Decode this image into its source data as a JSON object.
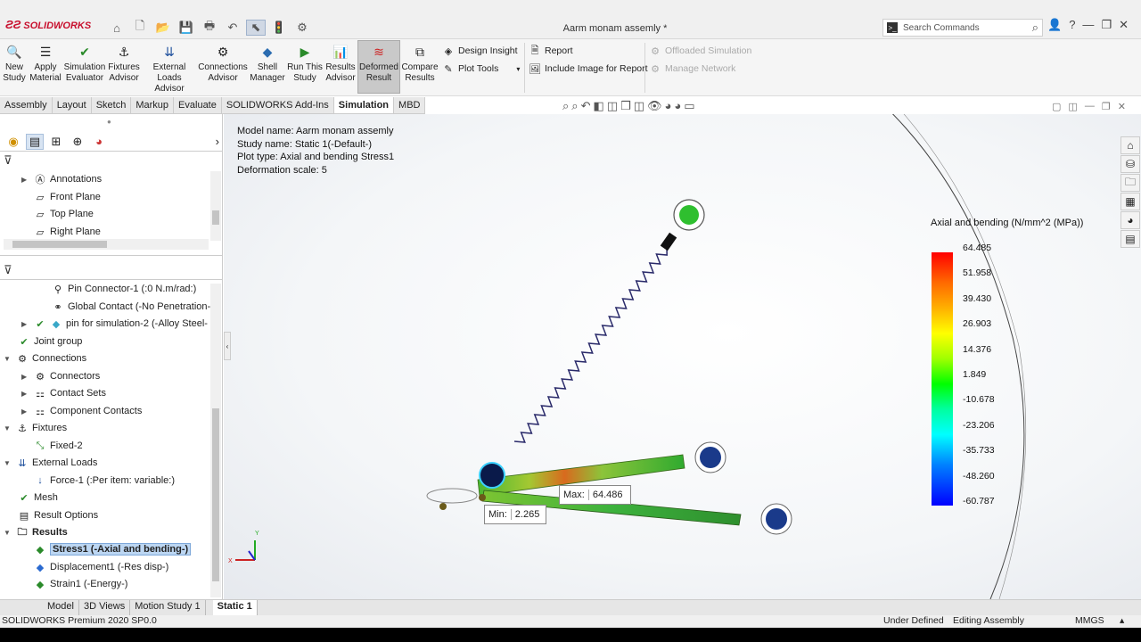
{
  "app": {
    "logo": "SOLIDWORKS",
    "document_title": "Aarm monam assemly *",
    "search_placeholder": "Search Commands"
  },
  "ribbon": {
    "buttons": [
      {
        "label": "New Study",
        "icon": "new-study-icon"
      },
      {
        "label": "Apply Material",
        "icon": "apply-material-icon"
      },
      {
        "label": "Simulation Evaluator",
        "icon": "simulation-evaluator-icon"
      },
      {
        "label": "Fixtures Advisor",
        "icon": "fixtures-advisor-icon"
      },
      {
        "label": "External Loads Advisor",
        "icon": "external-loads-icon"
      },
      {
        "label": "Connections Advisor",
        "icon": "connections-advisor-icon"
      },
      {
        "label": "Shell Manager",
        "icon": "shell-manager-icon"
      },
      {
        "label": "Run This Study",
        "icon": "run-study-icon"
      },
      {
        "label": "Results Advisor",
        "icon": "results-advisor-icon"
      },
      {
        "label": "Deformed Result",
        "icon": "deformed-result-icon"
      },
      {
        "label": "Compare Results",
        "icon": "compare-results-icon"
      }
    ],
    "small_buttons": {
      "design_insight": "Design Insight",
      "plot_tools": "Plot Tools",
      "report": "Report",
      "include_image": "Include Image for Report",
      "offloaded_simulation": "Offloaded Simulation",
      "manage_network": "Manage Network"
    }
  },
  "command_tabs": [
    "Assembly",
    "Layout",
    "Sketch",
    "Markup",
    "Evaluate",
    "SOLIDWORKS Add-Ins",
    "Simulation",
    "MBD"
  ],
  "active_command_tab": "Simulation",
  "feature_tree": {
    "items": [
      {
        "label": "Annotations"
      },
      {
        "label": "Front Plane"
      },
      {
        "label": "Top Plane"
      },
      {
        "label": "Right Plane"
      }
    ]
  },
  "sim_tree": {
    "items": [
      {
        "label": "Pin Connector-1 (:0 N.m/rad:)"
      },
      {
        "label": "Global Contact (-No Penetration-)"
      },
      {
        "label": "pin for simulation-2 (-Alloy Steel-"
      },
      {
        "label": "Joint group"
      },
      {
        "label": "Connections"
      },
      {
        "label": "Connectors"
      },
      {
        "label": "Contact Sets"
      },
      {
        "label": "Component Contacts"
      },
      {
        "label": "Fixtures"
      },
      {
        "label": "Fixed-2"
      },
      {
        "label": "External Loads"
      },
      {
        "label": "Force-1 (:Per item: variable:)"
      },
      {
        "label": "Mesh"
      },
      {
        "label": "Result Options"
      },
      {
        "label": "Results"
      },
      {
        "label": "Stress1 (-Axial and bending-)"
      },
      {
        "label": "Displacement1 (-Res disp-)"
      },
      {
        "label": "Strain1 (-Energy-)"
      }
    ]
  },
  "model_info": {
    "model_name": "Model name: Aarm monam assemly",
    "study_name": "Study name: Static 1(-Default-)",
    "plot_type": "Plot type: Axial and bending Stress1",
    "deformation_scale": "Deformation scale: 5"
  },
  "legend": {
    "title": "Axial and bending (N/mm^2 (MPa))",
    "ticks": [
      "64.485",
      "51.958",
      "39.430",
      "26.903",
      "14.376",
      "1.849",
      "-10.678",
      "-23.206",
      "-35.733",
      "-48.260",
      "-60.787"
    ],
    "color_max": "#ff0000",
    "color_min": "#0000ff"
  },
  "annotations": {
    "max_label": "Max:",
    "max_value": "64.486",
    "min_label": "Min:",
    "min_value": "2.265"
  },
  "bottom_tabs": [
    "Model",
    "3D Views",
    "Motion Study 1",
    "Static 1"
  ],
  "active_bottom_tab": "Static 1",
  "status": {
    "version": "SOLIDWORKS Premium 2020 SP0.0",
    "state": "Under Defined",
    "mode": "Editing Assembly",
    "units": "MMGS"
  }
}
